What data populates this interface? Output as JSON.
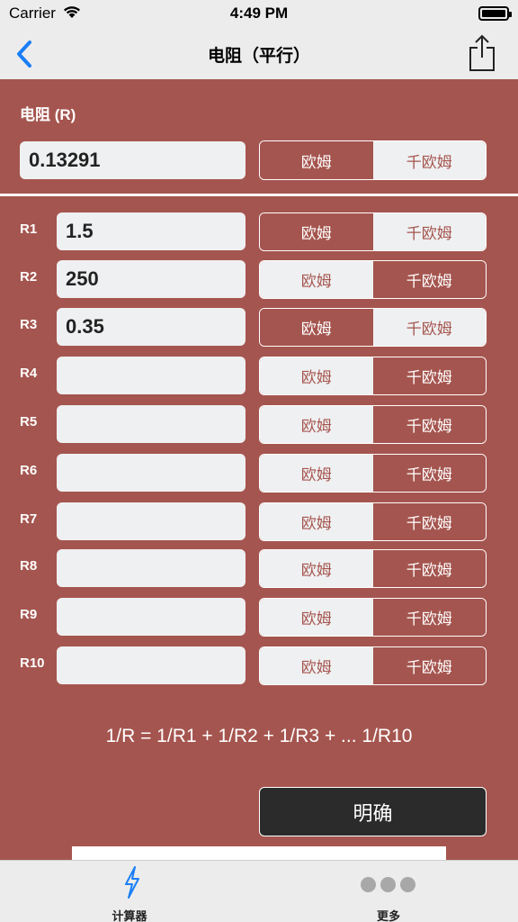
{
  "status_bar": {
    "carrier": "Carrier",
    "time": "4:49 PM"
  },
  "nav": {
    "title": "电阻（平行）",
    "back_icon": "chevron-left-icon",
    "share_icon": "share-icon",
    "accent": "#1a7ef5"
  },
  "result": {
    "label": "电阻 (R)",
    "value": "0.13291",
    "units": [
      "欧姆",
      "千欧姆"
    ],
    "selected_unit": "欧姆"
  },
  "inputs": [
    {
      "label": "R1",
      "value": "1.5",
      "selected_unit": "欧姆"
    },
    {
      "label": "R2",
      "value": "250",
      "selected_unit": "千欧姆"
    },
    {
      "label": "R3",
      "value": "0.35",
      "selected_unit": "欧姆"
    },
    {
      "label": "R4",
      "value": "",
      "selected_unit": "千欧姆"
    },
    {
      "label": "R5",
      "value": "",
      "selected_unit": "千欧姆"
    },
    {
      "label": "R6",
      "value": "",
      "selected_unit": "千欧姆"
    },
    {
      "label": "R7",
      "value": "",
      "selected_unit": "千欧姆"
    },
    {
      "label": "R8",
      "value": "",
      "selected_unit": "千欧姆"
    },
    {
      "label": "R9",
      "value": "",
      "selected_unit": "千欧姆"
    },
    {
      "label": "R10",
      "value": "",
      "selected_unit": "千欧姆"
    }
  ],
  "unit_options": [
    "欧姆",
    "千欧姆"
  ],
  "formula": "1/R = 1/R1 + 1/R2 + 1/R3 + ... 1/R10",
  "clear_button": "明确",
  "tabbar": [
    {
      "label": "计算器",
      "icon": "lightning-icon"
    },
    {
      "label": "更多",
      "icon": "more-dots-icon"
    }
  ],
  "colors": {
    "panel": "#a5554f",
    "field": "#eff0f1",
    "button_dark": "#2b2b2b"
  }
}
